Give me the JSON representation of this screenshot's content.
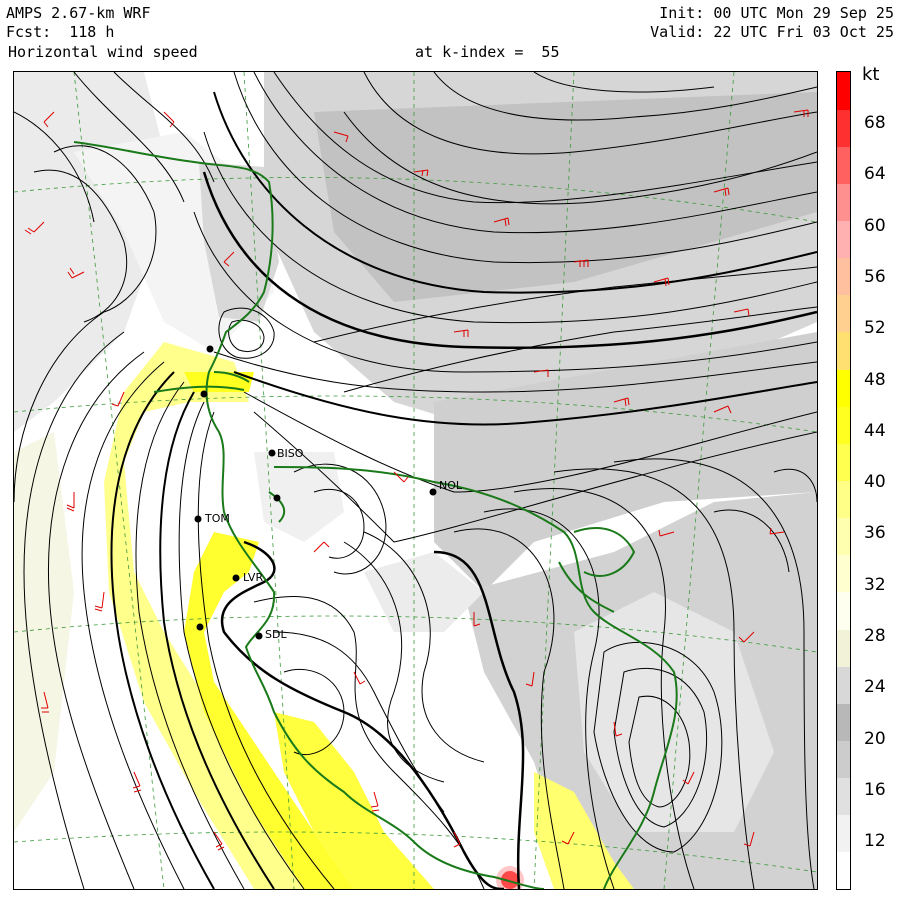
{
  "header": {
    "model": "AMPS 2.67-km WRF",
    "forecast": "Fcst:  118 h",
    "field": "Horizontal wind speed",
    "level": "at k-index =  55",
    "init": "Init: 00 UTC Mon 29 Sep 25",
    "valid": "Valid: 22 UTC Fri 03 Oct 25"
  },
  "colorbar": {
    "unit": "kt",
    "labels": [
      "68",
      "64",
      "60",
      "56",
      "52",
      "48",
      "44",
      "40",
      "36",
      "32",
      "28",
      "24",
      "20",
      "16",
      "12"
    ],
    "level_colors": [
      "#ffffff",
      "#f2f2f2",
      "#e0e0e0",
      "#cccccc",
      "#b8b8b8",
      "#d8d8d8",
      "#f2f2d8",
      "#fffff0",
      "#ffffd0",
      "#ffffb0",
      "#ffff88",
      "#ffff50",
      "#ffff20",
      "#ffff00",
      "#ffe070",
      "#ffd090",
      "#ffc0a0",
      "#ffb0b0",
      "#ff9090",
      "#ff6060",
      "#ff3030",
      "#ff0000"
    ]
  },
  "stations": [
    {
      "id": "stn-biso",
      "label": "BISO"
    },
    {
      "id": "stn-nol",
      "label": "NOL"
    },
    {
      "id": "stn-tom",
      "label": "TOM"
    },
    {
      "id": "stn-lvr",
      "label": "LVR"
    },
    {
      "id": "stn-sdl",
      "label": "SDL"
    }
  ],
  "map_layers": {
    "shading": "wind speed",
    "contours": "streamlines",
    "vectors": "wind barbs",
    "coast_color": "#1a7a1a",
    "barb_color": "#e00000",
    "grid_color": "#3a9a3a"
  }
}
